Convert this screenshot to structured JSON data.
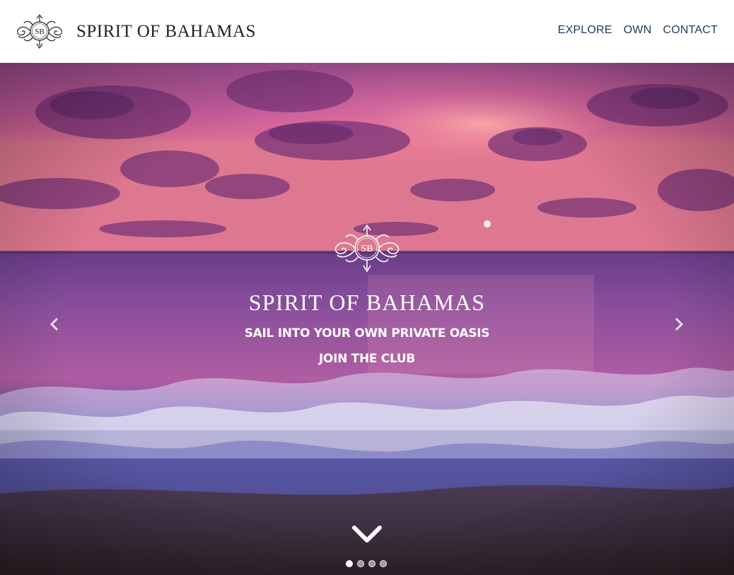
{
  "brand": {
    "name": "SPIRIT OF BAHAMAS",
    "monogram": "SB",
    "icon": "sb-monogram-logo"
  },
  "nav": {
    "items": [
      {
        "label": "EXPLORE"
      },
      {
        "label": "OWN"
      },
      {
        "label": "CONTACT"
      }
    ]
  },
  "hero": {
    "title": "SPIRIT OF BAHAMAS",
    "monogram": "SB",
    "tagline": "SAIL INTO YOUR OWN PRIVATE OASIS",
    "cta": "JOIN THE CLUB",
    "background": "sunset-ocean-waves-photo",
    "prev_icon": "chevron-left-icon",
    "next_icon": "chevron-right-icon",
    "scroll_icon": "chevron-down-icon",
    "slides_count": 4,
    "active_slide": 1
  },
  "colors": {
    "nav_text": "#1e3a5f",
    "brand_text": "#222222",
    "hero_text": "#ffffff"
  }
}
